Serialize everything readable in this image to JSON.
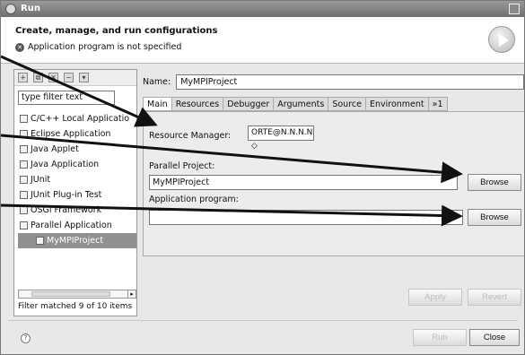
{
  "window": {
    "title": "Run"
  },
  "header": {
    "title": "Create, manage, and run configurations",
    "message": "Application program is not specified"
  },
  "left": {
    "filter_placeholder": "type filter text",
    "tree": [
      {
        "label": "C/C++ Local Applicatio",
        "icon": "cpp-local-app-icon"
      },
      {
        "label": "Eclipse Application",
        "icon": "eclipse-icon"
      },
      {
        "label": "Java Applet",
        "icon": "java-applet-icon"
      },
      {
        "label": "Java Application",
        "icon": "java-app-icon"
      },
      {
        "label": "JUnit",
        "icon": "junit-icon"
      },
      {
        "label": "JUnit Plug-in Test",
        "icon": "junit-plugin-icon"
      },
      {
        "label": "OSGi Framework",
        "icon": "osgi-icon"
      },
      {
        "label": "Parallel Application",
        "icon": "parallel-app-icon"
      },
      {
        "label": "MyMPIProject",
        "icon": "mpi-project-icon"
      }
    ],
    "filter_status": "Filter matched 9 of 10 items"
  },
  "right": {
    "name_label": "Name:",
    "name_value": "MyMPIProject",
    "tabs": [
      "Main",
      "Resources",
      "Debugger",
      "Arguments",
      "Source",
      "Environment",
      "»1"
    ],
    "resource_manager_label": "Resource Manager:",
    "resource_manager_value": "ORTE@N.N.N.N",
    "parallel_project_label": "Parallel Project:",
    "parallel_project_value": "MyMPIProject",
    "application_program_label": "Application program:",
    "application_program_value": "",
    "browse": "Browse",
    "apply": "Apply",
    "revert": "Revert"
  },
  "footer": {
    "run": "Run",
    "close": "Close"
  }
}
